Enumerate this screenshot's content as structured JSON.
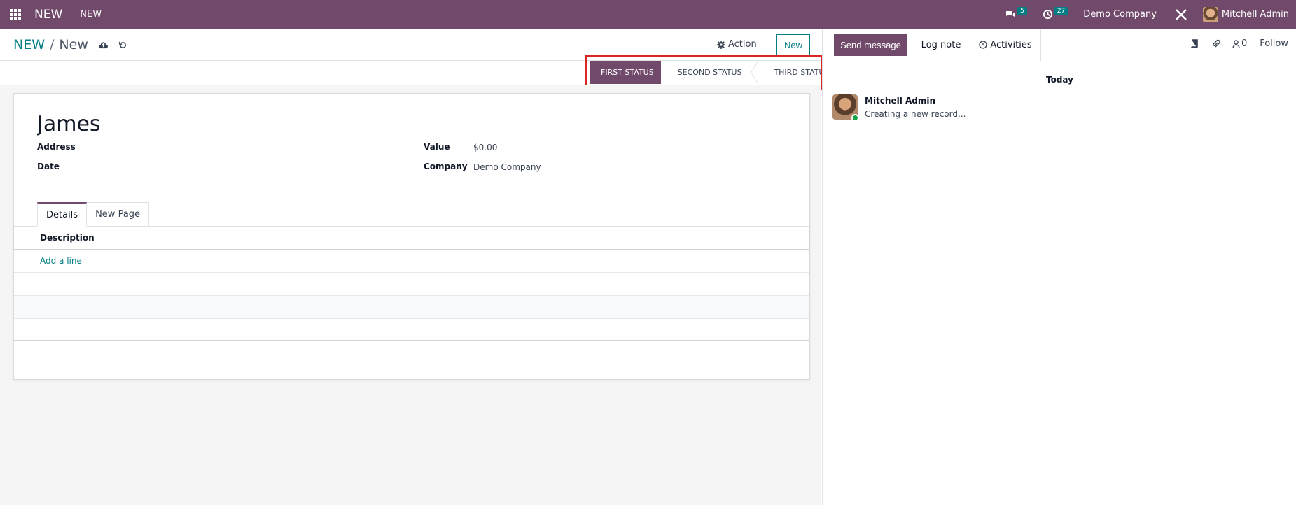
{
  "navbar": {
    "brand": "NEW",
    "menu_item": "NEW",
    "messages_count": "5",
    "activities_count": "27",
    "company": "Demo Company",
    "user": "Mitchell Admin"
  },
  "control": {
    "breadcrumb_parent": "NEW",
    "breadcrumb_sep": "/",
    "breadcrumb_current": "New",
    "action_label": "Action",
    "new_label": "New"
  },
  "statusbar": {
    "statuses": [
      "FIRST STATUS",
      "SECOND STATUS",
      "THIRD STATUS"
    ],
    "active": "FIRST STATUS"
  },
  "form": {
    "name_value": "James",
    "fields": {
      "address_label": "Address",
      "date_label": "Date",
      "value_label": "Value",
      "value_value": "$0.00",
      "company_label": "Company",
      "company_value": "Demo Company"
    },
    "tabs": [
      "Details",
      "New Page"
    ],
    "table": {
      "column_description": "Description",
      "add_line": "Add a line"
    }
  },
  "chatter": {
    "send_message": "Send message",
    "log_note": "Log note",
    "activities": "Activities",
    "followers_count": "0",
    "follow": "Follow",
    "today": "Today",
    "message_author": "Mitchell Admin",
    "message_body": "Creating a new record..."
  },
  "colors": {
    "brand": "#71496a",
    "accent": "#017e84",
    "highlight": "#dc2626"
  }
}
